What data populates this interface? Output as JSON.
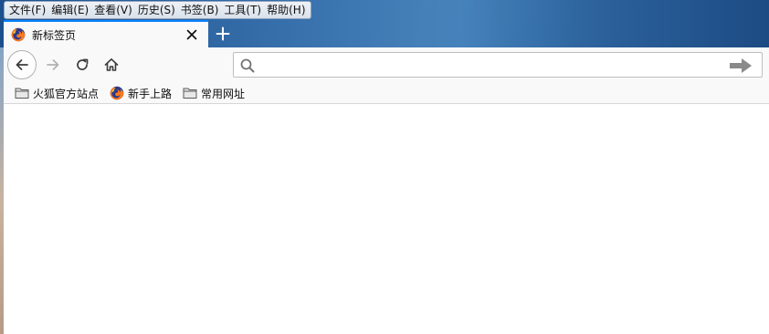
{
  "menubar": {
    "items": [
      "文件(F)",
      "编辑(E)",
      "查看(V)",
      "历史(S)",
      "书签(B)",
      "工具(T)",
      "帮助(H)"
    ]
  },
  "tab": {
    "title": "新标签页",
    "close_glyph": "✕",
    "favicon": "firefox-icon"
  },
  "new_tab": {
    "glyph": "+"
  },
  "navbar": {
    "back_icon": "arrow-left-icon",
    "forward_icon": "arrow-right-icon",
    "reload_icon": "reload-icon",
    "home_icon": "home-icon"
  },
  "urlbar": {
    "value": "",
    "placeholder": "",
    "search_icon": "search-icon",
    "go_icon": "go-arrow-icon"
  },
  "bookmarks": [
    {
      "label": "火狐官方站点",
      "icon": "folder-icon"
    },
    {
      "label": "新手上路",
      "icon": "firefox-icon"
    },
    {
      "label": "常用网址",
      "icon": "folder-icon"
    }
  ],
  "colors": {
    "tab_accent": "#0a84ff",
    "toolbar_bg": "#f9f9fa",
    "titlebar_blue": "#2d68a6"
  }
}
